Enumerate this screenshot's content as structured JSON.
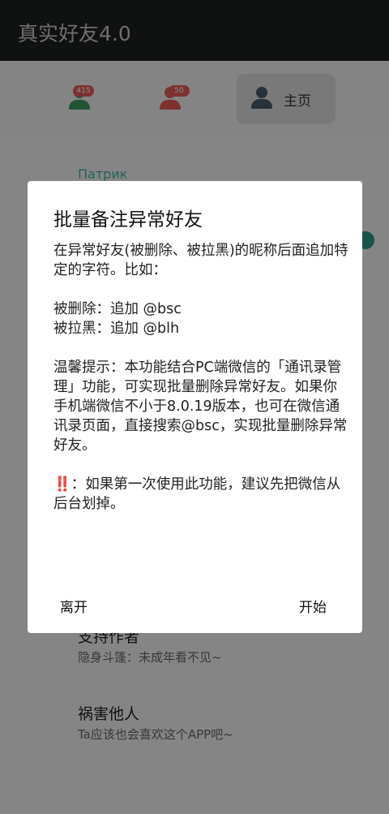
{
  "appbar": {
    "title": "真实好友4.0"
  },
  "tabs": {
    "deleted_badge": "415",
    "blocked_badge": "50",
    "home_label": "主页"
  },
  "background": {
    "section_label": "Патрик",
    "items": [
      {
        "title": "支持作者",
        "subtitle": "隐身斗篷：未成年看不见~"
      },
      {
        "title": "祸害他人",
        "subtitle": "Ta应该也会喜欢这个APP吧~"
      }
    ]
  },
  "dialog": {
    "title": "批量备注异常好友",
    "intro": "在异常好友(被删除、被拉黑)的昵称后面追加特定的字符。比如：",
    "rule_deleted": "被删除：追加 @bsc",
    "rule_blocked": "被拉黑：追加 @blh",
    "tip": "温馨提示：本功能结合PC端微信的「通讯录管理」功能，可实现批量删除异常好友。如果你手机端微信不小于8.0.19版本，也可在微信通讯录页面，直接搜索@bsc，实现批量删除异常好友。",
    "warning_mark": "‼️",
    "warning": "：如果第一次使用此功能，建议先把微信从后台划掉。",
    "leave_button": "离开",
    "start_button": "开始"
  },
  "colors": {
    "teal": "#3db79e",
    "green_icon": "#3f9a5f",
    "red_icon": "#e25b57",
    "home_icon": "#455a6a"
  }
}
